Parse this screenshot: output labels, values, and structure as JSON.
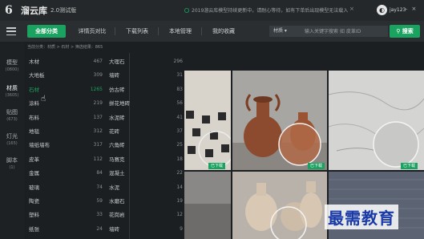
{
  "app": {
    "title": "溜云库",
    "version": "2.0测试版",
    "notice": "2019溜云库模型持续更新中，请耐心等待，如有下单后出现模型无法载入",
    "user": "jay123"
  },
  "nav": {
    "tabs": [
      "全部分类",
      "详情页对比",
      "下载列表",
      "本地管理",
      "我的收藏"
    ],
    "search_select": "材质",
    "search_placeholder": "输入关键字搜索 如 皮革ID",
    "search_btn": "搜索"
  },
  "leftbar": [
    {
      "label": "模型",
      "count": "(0800)"
    },
    {
      "label": "材质",
      "count": "(3605)"
    },
    {
      "label": "贴图",
      "count": "(673)"
    },
    {
      "label": "灯光",
      "count": "(165)"
    },
    {
      "label": "脚本",
      "count": "(1)"
    }
  ],
  "breadcrumb": "当前分类：材质 > 石材 > 筛选结果：865",
  "categories_left": [
    {
      "name": "木材",
      "count": "467"
    },
    {
      "name": "大地板",
      "count": "309"
    },
    {
      "name": "石材",
      "count": "1265"
    },
    {
      "name": "涂料",
      "count": "219"
    },
    {
      "name": "布料",
      "count": "137"
    },
    {
      "name": "地毯",
      "count": "312"
    },
    {
      "name": "墙纸墙布",
      "count": "317"
    },
    {
      "name": "皮革",
      "count": "112"
    },
    {
      "name": "金属",
      "count": "84"
    },
    {
      "name": "玻璃",
      "count": "74"
    },
    {
      "name": "陶瓷",
      "count": "59"
    },
    {
      "name": "塑料",
      "count": "33"
    },
    {
      "name": "纸张",
      "count": "24"
    }
  ],
  "categories_right": [
    {
      "name": "大理石",
      "count": "296"
    },
    {
      "name": "墙砖",
      "count": "31"
    },
    {
      "name": "仿古砖",
      "count": "83"
    },
    {
      "name": "拼花地砖",
      "count": "56"
    },
    {
      "name": "水泥砖",
      "count": "41"
    },
    {
      "name": "花砖",
      "count": "37"
    },
    {
      "name": "六角砖",
      "count": "25"
    },
    {
      "name": "马赛克",
      "count": "18"
    },
    {
      "name": "混凝土",
      "count": "22"
    },
    {
      "name": "水泥",
      "count": "14"
    },
    {
      "name": "水磨石",
      "count": "19"
    },
    {
      "name": "花岗岩",
      "count": "12"
    },
    {
      "name": "墙砖",
      "count": "9"
    }
  ],
  "tiles": {
    "badge": "已下载"
  },
  "watermark": "最需教育"
}
